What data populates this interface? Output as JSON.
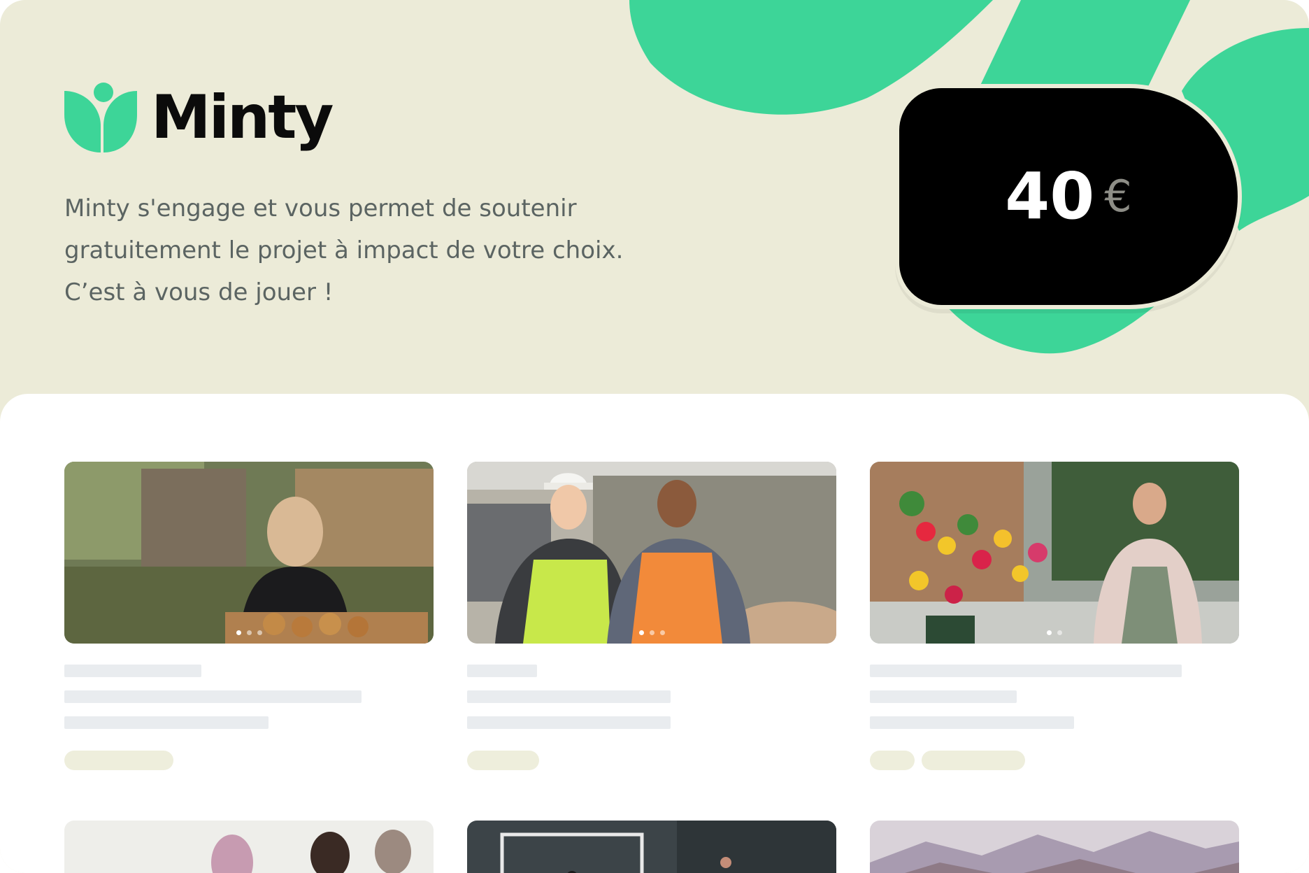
{
  "brand": {
    "name": "Minty",
    "green": "#3DD598",
    "cream": "#ECEBD8"
  },
  "intro": {
    "line1": "Minty s'engage et vous permet de soutenir",
    "line2": "gratuitement le projet à impact de votre choix.",
    "line3": "C’est à vous de jouer !"
  },
  "donation": {
    "amount": "40",
    "currency": "€"
  },
  "projects": [
    {
      "image": "woman-holding-crate-of-onions-photo",
      "carousel_dots": 3,
      "active_dot": 1
    },
    {
      "image": "two-women-in-safety-vests-photo",
      "carousel_dots": 3,
      "active_dot": 1
    },
    {
      "image": "woman-arranging-sunflowers-photo",
      "carousel_dots": 2,
      "active_dot": 1
    },
    {
      "image": "group-discussion-photo"
    },
    {
      "image": "football-goal-photo"
    },
    {
      "image": "mountain-landscape-photo"
    }
  ]
}
